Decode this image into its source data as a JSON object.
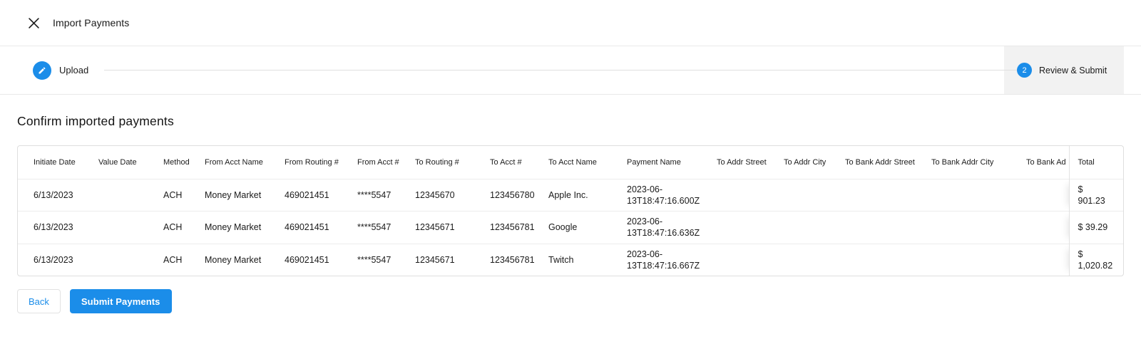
{
  "colors": {
    "primary_blue": "#1b8de9",
    "step_panel_gray": "#f2f2f2"
  },
  "header": {
    "title": "Import Payments"
  },
  "stepper": {
    "steps": [
      {
        "label": "Upload",
        "icon": "pencil-icon",
        "state": "completed"
      },
      {
        "label": "Review & Submit",
        "number": "2",
        "state": "active"
      }
    ]
  },
  "main": {
    "heading": "Confirm imported payments",
    "table": {
      "columns": [
        "Initiate Date",
        "Value Date",
        "Method",
        "From Acct Name",
        "From Routing #",
        "From Acct #",
        "To Routing #",
        "To Acct #",
        "To Acct Name",
        "Payment Name",
        "To Addr Street",
        "To Addr City",
        "To Bank Addr Street",
        "To Bank Addr City",
        "To Bank Ad",
        "Total"
      ],
      "rows": [
        [
          "6/13/2023",
          "",
          "ACH",
          "Money Market",
          "469021451",
          "****5547",
          "12345670",
          "123456780",
          "Apple Inc.",
          "2023-06-13T18:47:16.600Z",
          "",
          "",
          "",
          "",
          "",
          "$ 901.23"
        ],
        [
          "6/13/2023",
          "",
          "ACH",
          "Money Market",
          "469021451",
          "****5547",
          "12345671",
          "123456781",
          "Google",
          "2023-06-13T18:47:16.636Z",
          "",
          "",
          "",
          "",
          "",
          "$ 39.29"
        ],
        [
          "6/13/2023",
          "",
          "ACH",
          "Money Market",
          "469021451",
          "****5547",
          "12345671",
          "123456781",
          "Twitch",
          "2023-06-13T18:47:16.667Z",
          "",
          "",
          "",
          "",
          "",
          "$ 1,020.82"
        ]
      ]
    }
  },
  "footer": {
    "back_label": "Back",
    "submit_label": "Submit Payments"
  }
}
